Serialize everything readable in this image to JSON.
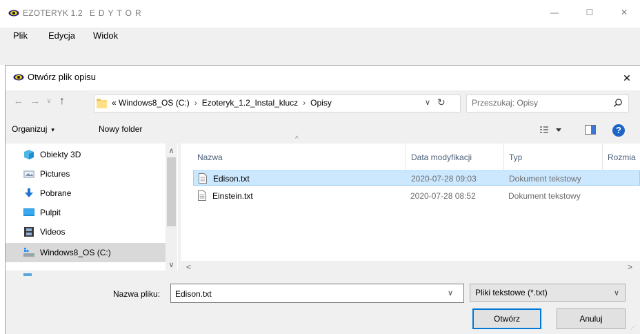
{
  "app": {
    "title": "EZOTERYK 1.2",
    "subtitle": "EDYTOR",
    "menu": [
      "Plik",
      "Edycja",
      "Widok"
    ],
    "window_controls": {
      "minimize": "—",
      "maximize": "☐",
      "close": "✕"
    }
  },
  "dialog": {
    "title": "Otwórz plik opisu",
    "close": "✕",
    "nav": {
      "back": "←",
      "forward": "→",
      "recent": "∨",
      "up": "↑"
    },
    "address": {
      "prefix": "«",
      "crumbs": [
        "Windows8_OS (C:)",
        "Ezoteryk_1.2_Instal_klucz",
        "Opisy"
      ],
      "separator": "›",
      "dropdown": "∨",
      "refresh": "↻"
    },
    "search": {
      "placeholder": "Przeszukaj: Opisy"
    },
    "toolbar": {
      "organize": "Organizuj",
      "organize_arrow": "▾",
      "new_folder": "Nowy folder",
      "help": "?"
    },
    "nav_pane": {
      "items": [
        {
          "label": "Obiekty 3D",
          "icon": "cube-3d-icon"
        },
        {
          "label": "Pictures",
          "icon": "pictures-folder-icon"
        },
        {
          "label": "Pobrane",
          "icon": "download-arrow-icon"
        },
        {
          "label": "Pulpit",
          "icon": "desktop-icon"
        },
        {
          "label": "Videos",
          "icon": "videos-folder-icon"
        },
        {
          "label": "Windows8_OS (C:)",
          "icon": "drive-icon",
          "selected": true
        }
      ],
      "scroll_up": "∧",
      "scroll_down": "∨"
    },
    "file_list": {
      "columns": [
        "Nazwa",
        "Data modyfikacji",
        "Typ",
        "Rozmia"
      ],
      "sort_arrow": "^",
      "rows": [
        {
          "name": "Edison.txt",
          "modified": "2020-07-28 09:03",
          "type": "Dokument tekstowy",
          "selected": true
        },
        {
          "name": "Einstein.txt",
          "modified": "2020-07-28 08:52",
          "type": "Dokument tekstowy",
          "selected": false
        }
      ],
      "hscroll_left": "<",
      "hscroll_right": ">"
    },
    "filename": {
      "label": "Nazwa pliku:",
      "value": "Edison.txt",
      "dropdown": "∨"
    },
    "filetype": {
      "value": "Pliki tekstowe (*.txt)",
      "arrow": "∨"
    },
    "buttons": {
      "open": "Otwórz",
      "cancel": "Anuluj"
    }
  },
  "colors": {
    "selection_bg": "#cce8ff",
    "selection_border": "#99d1ff",
    "accent": "#0078d7",
    "help": "#1c64c8",
    "chrome": "#f0f0f0"
  }
}
